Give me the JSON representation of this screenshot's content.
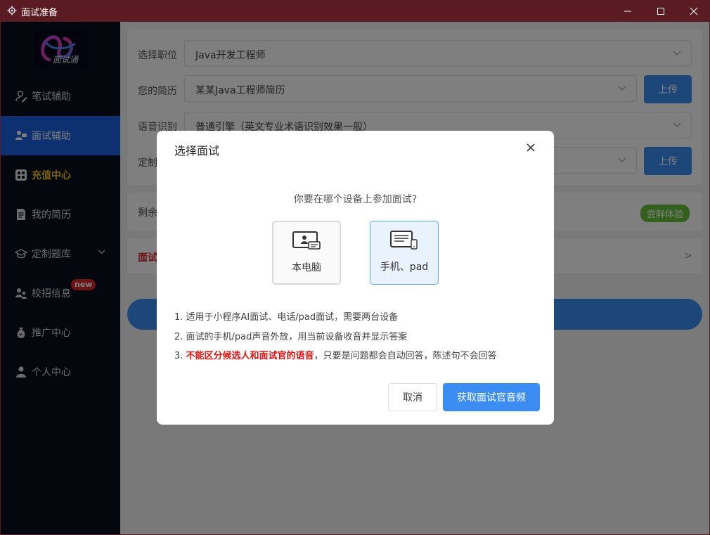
{
  "window": {
    "title": "面试准备",
    "icon": "gear-icon"
  },
  "sidebar": {
    "logo_text": "面试通",
    "items": [
      {
        "label": "笔试辅助",
        "icon": "user-edit-icon"
      },
      {
        "label": "面试辅助",
        "icon": "interview-icon"
      },
      {
        "label": "充值中心",
        "icon": "grid-icon"
      },
      {
        "label": "我的简历",
        "icon": "document-icon"
      },
      {
        "label": "定制题库",
        "icon": "graduation-cap-icon"
      },
      {
        "label": "校招信息",
        "icon": "users-icon",
        "badge": "new"
      },
      {
        "label": "推广中心",
        "icon": "money-bag-icon"
      },
      {
        "label": "个人中心",
        "icon": "person-icon"
      }
    ],
    "active_index": 1,
    "accent": "#1a63e0",
    "highlight_color": "#f2c611"
  },
  "form": {
    "position_label": "选择职位",
    "position_value": "Java开发工程师",
    "resume_label": "您的简历",
    "resume_value": "某某Java工程师简历",
    "upload_label": "上传",
    "speech_label": "语音识别",
    "speech_value": "普通引擎（英文专业术语识别效果一般）",
    "custom_label": "定制",
    "custom_upload_label": "上传"
  },
  "status": {
    "remaining_label": "剩余",
    "trial_label": "尝鲜体验"
  },
  "interview": {
    "label": "面试",
    "arrow": ">"
  },
  "dialog": {
    "title": "选择面试",
    "question": "你要在哪个设备上参加面试?",
    "options": [
      {
        "label": "本电脑",
        "icon": "computer-icon"
      },
      {
        "label": "手机、pad",
        "icon": "mobile-pad-icon"
      }
    ],
    "notes": [
      {
        "text": "1. 适用于小程序AI面试、电话/pad面试，需要两台设备"
      },
      {
        "text": "2. 面试的手机/pad声音外放，用当前设备收音并显示答案"
      },
      {
        "prefix": "3. ",
        "highlight": "不能区分候选人和面试官的语音",
        "rest": "，只要是问题都会自动回答，陈述句不会回答"
      }
    ],
    "cancel_label": "取消",
    "confirm_label": "获取面试官音频"
  },
  "colors": {
    "primary": "#3b8cf3",
    "warning_text": "#e01212",
    "trial_tag": "#67c23a",
    "titlebar": "#5a1c22"
  }
}
